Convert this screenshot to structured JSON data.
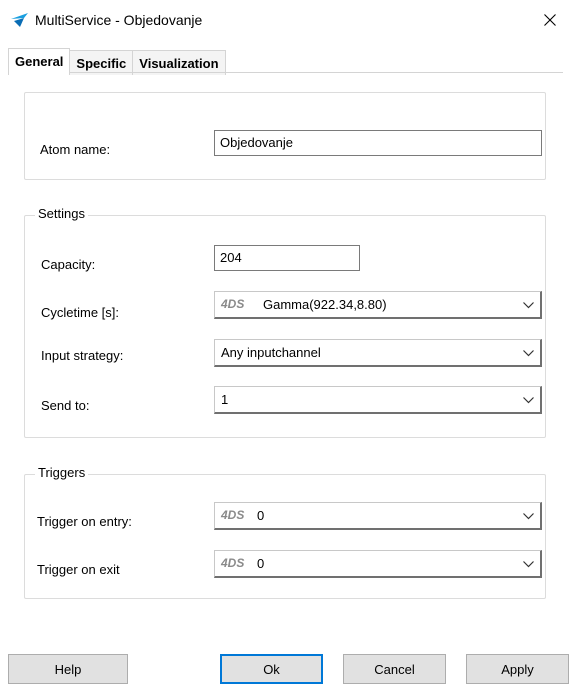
{
  "window": {
    "title": "MultiService - Objedovanje",
    "app_icon": "multiservice-logo-icon",
    "close_icon": "close-icon",
    "accent": "#0078d7"
  },
  "tabs": [
    {
      "label": "General",
      "active": true
    },
    {
      "label": "Specific",
      "active": false
    },
    {
      "label": "Visualization",
      "active": false
    }
  ],
  "atom": {
    "label": "Atom name:",
    "value": "Objedovanje"
  },
  "settings": {
    "title": "Settings",
    "capacity": {
      "label": "Capacity:",
      "value": "204"
    },
    "cycletime": {
      "label": "Cycletime [s]:",
      "prefix": "4DS",
      "value": "Gamma(922.34,8.80)"
    },
    "input_strategy": {
      "label": "Input strategy:",
      "value": "Any inputchannel"
    },
    "send_to": {
      "label": "Send to:",
      "value": "1"
    }
  },
  "triggers": {
    "title": "Triggers",
    "on_entry": {
      "label": "Trigger on entry:",
      "prefix": "4DS",
      "value": "0"
    },
    "on_exit": {
      "label": "Trigger on exit",
      "prefix": "4DS",
      "value": "0"
    }
  },
  "buttons": {
    "help": "Help",
    "ok": "Ok",
    "cancel": "Cancel",
    "apply": "Apply"
  }
}
